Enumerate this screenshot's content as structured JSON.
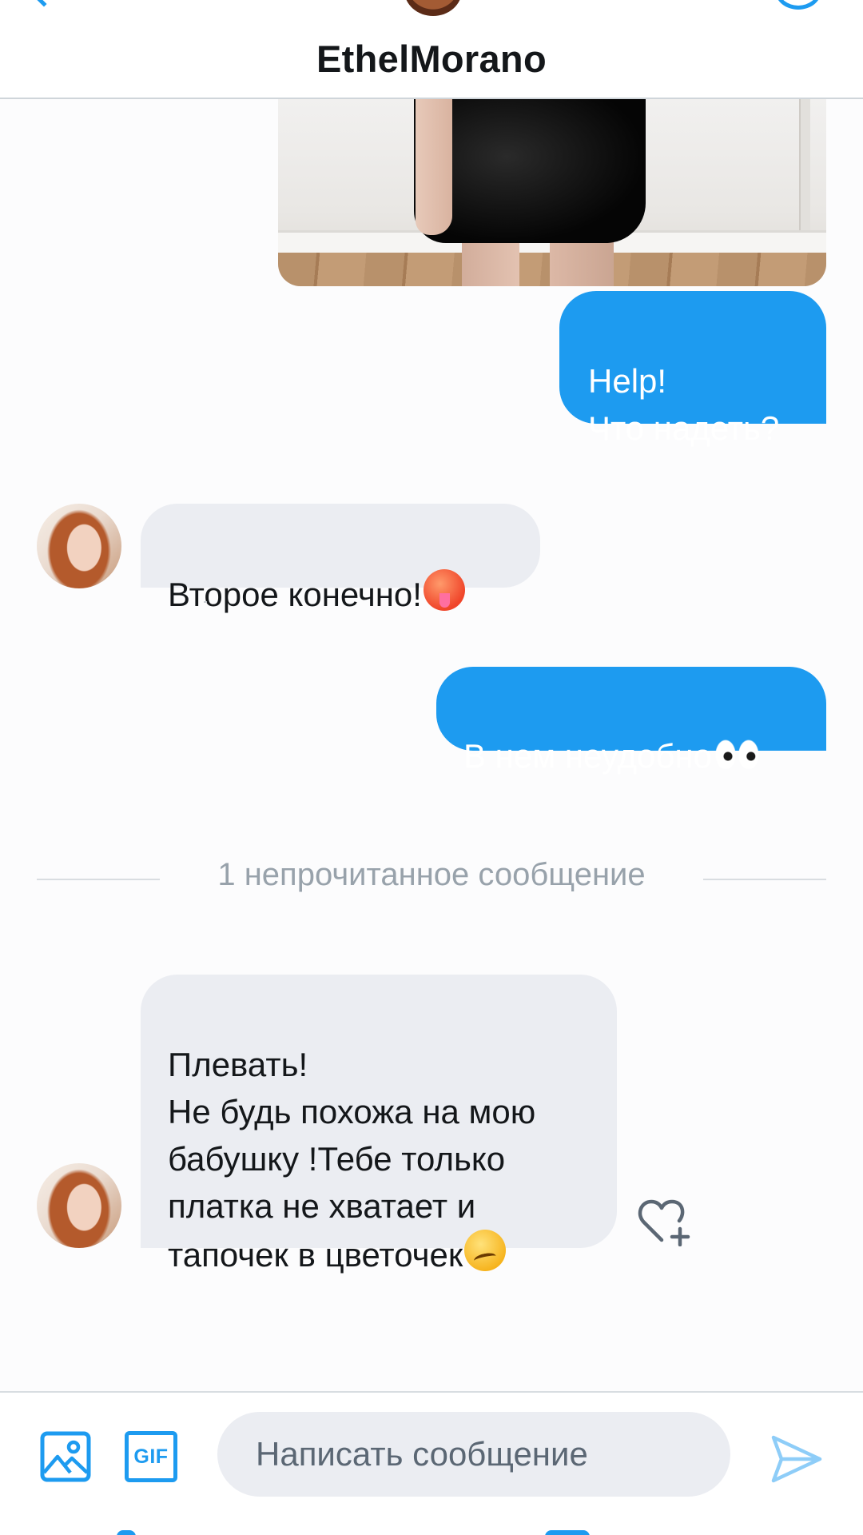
{
  "header": {
    "title": "EthelMorano"
  },
  "messages": {
    "m1": "Help!\nЧто надеть?",
    "m2": "Второе конечно!",
    "m3": "В нем неудобно",
    "m4": "Плевать!\nНе будь похожа на мою бабушку !Тебе только платка не хватает и тапочек в цветочек"
  },
  "icons": {
    "m2_emoji": "hot-face",
    "m3_emoji": "eyes",
    "m4_emoji": "woozy-face"
  },
  "divider": {
    "text": "1 непрочитанное сообщение"
  },
  "composer": {
    "gif_label": "GIF",
    "placeholder": "Написать сообщение"
  },
  "colors": {
    "accent": "#1d9bf0",
    "incoming_bubble": "#ebedf2"
  }
}
